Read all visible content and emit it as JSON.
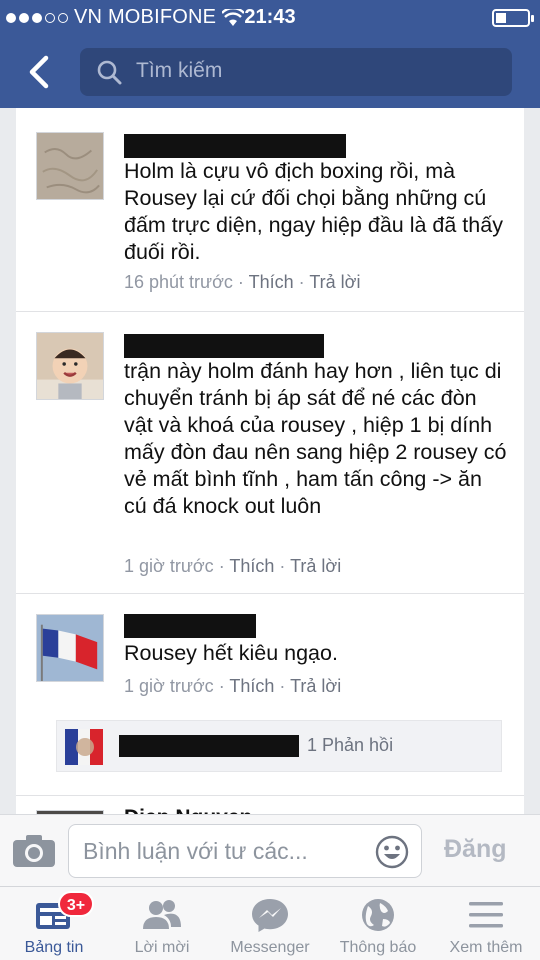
{
  "status_bar": {
    "carrier": "VN MOBIFONE",
    "time": "21:43"
  },
  "nav": {
    "search_placeholder": "Tìm kiếm"
  },
  "comments": [
    {
      "text": "Holm là cựu vô địch boxing rồi, mà Rousey lại cứ đối chọi bằng những cú đấm trực diện, ngay hiệp đầu là đã thấy đuối rồi.",
      "time": "16 phút trước",
      "like": "Thích",
      "reply": "Trả lời"
    },
    {
      "text": "trận này holm đánh hay hơn , liên tục di chuyển tránh bị áp sát để né các đòn vật và khoá của rousey , hiệp 1 bị dính mấy đòn đau nên sang hiệp 2 rousey có vẻ mất bình tĩnh , ham tấn công -> ăn cú đá knock out luôn",
      "time": "1 giờ trước",
      "like": "Thích",
      "reply": "Trả lời"
    },
    {
      "text": "Rousey hết kiêu ngạo.",
      "time": "1 giờ trước",
      "like": "Thích",
      "reply": "Trả lời",
      "replies_label": "1 Phản hồi"
    },
    {
      "name": "Diep Nguyen"
    }
  ],
  "composer": {
    "placeholder": "Bình luận với tư các...",
    "post_label": "Đăng"
  },
  "tabs": [
    {
      "label": "Bảng tin",
      "badge": "3+"
    },
    {
      "label": "Lời mời"
    },
    {
      "label": "Messenger"
    },
    {
      "label": "Thông báo"
    },
    {
      "label": "Xem thêm"
    }
  ],
  "colors": {
    "brand": "#3b5998",
    "badge": "#f0283c"
  }
}
